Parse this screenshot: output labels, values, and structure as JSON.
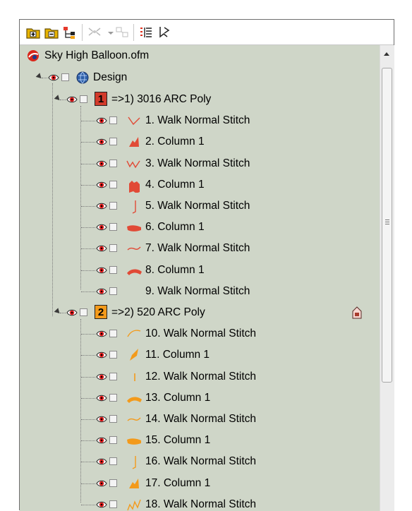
{
  "toolbar": {
    "buttons": [
      {
        "name": "add-folder-button",
        "icon": "folder-plus-icon"
      },
      {
        "name": "remove-folder-button",
        "icon": "folder-minus-icon"
      },
      {
        "name": "tree-structure-button",
        "icon": "tree-icon"
      },
      {
        "name": "group-objects-button",
        "icon": "group-icon"
      },
      {
        "name": "group-dropdown-button",
        "icon": "chevron-down-icon"
      },
      {
        "name": "ungroup-objects-button",
        "icon": "ungroup-icon"
      },
      {
        "name": "sequence-list-button",
        "icon": "list-icon"
      },
      {
        "name": "filter-button",
        "icon": "filter-icon"
      }
    ]
  },
  "tree": {
    "root_label": "Sky High Balloon.ofm",
    "design_label": "Design",
    "groups": [
      {
        "badge": "1",
        "badge_color": "#d23b2b",
        "label": "=>1) 3016 ARC Poly",
        "color": "#e14a36",
        "locked": false,
        "items": [
          {
            "label": "1. Walk Normal Stitch",
            "thumb": "stitch-v"
          },
          {
            "label": "2. Column 1",
            "thumb": "fill-a"
          },
          {
            "label": "3. Walk Normal Stitch",
            "thumb": "stitch-w"
          },
          {
            "label": "4. Column 1",
            "thumb": "fill-b"
          },
          {
            "label": "5. Walk Normal Stitch",
            "thumb": "stitch-l"
          },
          {
            "label": "6. Column 1",
            "thumb": "fill-c"
          },
          {
            "label": "7. Walk Normal Stitch",
            "thumb": "stitch-s"
          },
          {
            "label": "8. Column 1",
            "thumb": "fill-d"
          },
          {
            "label": "9. Walk Normal Stitch",
            "thumb": "none"
          }
        ]
      },
      {
        "badge": "2",
        "badge_color": "#f39a1b",
        "label": "=>2) 520 ARC Poly",
        "color": "#f39a1b",
        "locked": true,
        "items": [
          {
            "label": "10. Walk Normal Stitch",
            "thumb": "stitch-arc"
          },
          {
            "label": "11. Column 1",
            "thumb": "fill-e"
          },
          {
            "label": "12. Walk Normal Stitch",
            "thumb": "stitch-i"
          },
          {
            "label": "13. Column 1",
            "thumb": "fill-d"
          },
          {
            "label": "14. Walk Normal Stitch",
            "thumb": "stitch-s"
          },
          {
            "label": "15. Column 1",
            "thumb": "fill-c"
          },
          {
            "label": "16. Walk Normal Stitch",
            "thumb": "stitch-l"
          },
          {
            "label": "17. Column 1",
            "thumb": "fill-a"
          },
          {
            "label": "18. Walk Normal Stitch",
            "thumb": "stitch-n"
          }
        ]
      }
    ]
  }
}
